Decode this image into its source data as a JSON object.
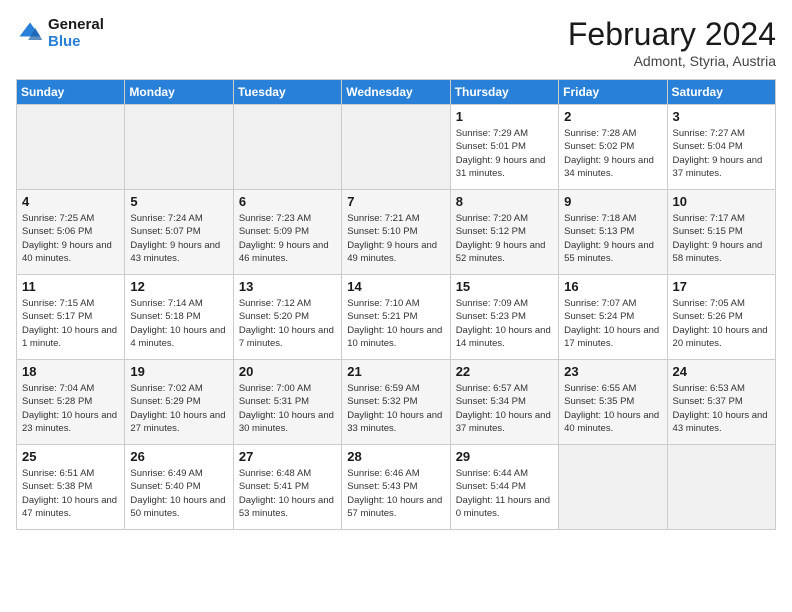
{
  "logo": {
    "line1": "General",
    "line2": "Blue"
  },
  "title": "February 2024",
  "subtitle": "Admont, Styria, Austria",
  "days_of_week": [
    "Sunday",
    "Monday",
    "Tuesday",
    "Wednesday",
    "Thursday",
    "Friday",
    "Saturday"
  ],
  "weeks": [
    [
      {
        "day": "",
        "empty": true
      },
      {
        "day": "",
        "empty": true
      },
      {
        "day": "",
        "empty": true
      },
      {
        "day": "",
        "empty": true
      },
      {
        "day": "1",
        "sunrise": "7:29 AM",
        "sunset": "5:01 PM",
        "daylight": "9 hours and 31 minutes."
      },
      {
        "day": "2",
        "sunrise": "7:28 AM",
        "sunset": "5:02 PM",
        "daylight": "9 hours and 34 minutes."
      },
      {
        "day": "3",
        "sunrise": "7:27 AM",
        "sunset": "5:04 PM",
        "daylight": "9 hours and 37 minutes."
      }
    ],
    [
      {
        "day": "4",
        "sunrise": "7:25 AM",
        "sunset": "5:06 PM",
        "daylight": "9 hours and 40 minutes."
      },
      {
        "day": "5",
        "sunrise": "7:24 AM",
        "sunset": "5:07 PM",
        "daylight": "9 hours and 43 minutes."
      },
      {
        "day": "6",
        "sunrise": "7:23 AM",
        "sunset": "5:09 PM",
        "daylight": "9 hours and 46 minutes."
      },
      {
        "day": "7",
        "sunrise": "7:21 AM",
        "sunset": "5:10 PM",
        "daylight": "9 hours and 49 minutes."
      },
      {
        "day": "8",
        "sunrise": "7:20 AM",
        "sunset": "5:12 PM",
        "daylight": "9 hours and 52 minutes."
      },
      {
        "day": "9",
        "sunrise": "7:18 AM",
        "sunset": "5:13 PM",
        "daylight": "9 hours and 55 minutes."
      },
      {
        "day": "10",
        "sunrise": "7:17 AM",
        "sunset": "5:15 PM",
        "daylight": "9 hours and 58 minutes."
      }
    ],
    [
      {
        "day": "11",
        "sunrise": "7:15 AM",
        "sunset": "5:17 PM",
        "daylight": "10 hours and 1 minute."
      },
      {
        "day": "12",
        "sunrise": "7:14 AM",
        "sunset": "5:18 PM",
        "daylight": "10 hours and 4 minutes."
      },
      {
        "day": "13",
        "sunrise": "7:12 AM",
        "sunset": "5:20 PM",
        "daylight": "10 hours and 7 minutes."
      },
      {
        "day": "14",
        "sunrise": "7:10 AM",
        "sunset": "5:21 PM",
        "daylight": "10 hours and 10 minutes."
      },
      {
        "day": "15",
        "sunrise": "7:09 AM",
        "sunset": "5:23 PM",
        "daylight": "10 hours and 14 minutes."
      },
      {
        "day": "16",
        "sunrise": "7:07 AM",
        "sunset": "5:24 PM",
        "daylight": "10 hours and 17 minutes."
      },
      {
        "day": "17",
        "sunrise": "7:05 AM",
        "sunset": "5:26 PM",
        "daylight": "10 hours and 20 minutes."
      }
    ],
    [
      {
        "day": "18",
        "sunrise": "7:04 AM",
        "sunset": "5:28 PM",
        "daylight": "10 hours and 23 minutes."
      },
      {
        "day": "19",
        "sunrise": "7:02 AM",
        "sunset": "5:29 PM",
        "daylight": "10 hours and 27 minutes."
      },
      {
        "day": "20",
        "sunrise": "7:00 AM",
        "sunset": "5:31 PM",
        "daylight": "10 hours and 30 minutes."
      },
      {
        "day": "21",
        "sunrise": "6:59 AM",
        "sunset": "5:32 PM",
        "daylight": "10 hours and 33 minutes."
      },
      {
        "day": "22",
        "sunrise": "6:57 AM",
        "sunset": "5:34 PM",
        "daylight": "10 hours and 37 minutes."
      },
      {
        "day": "23",
        "sunrise": "6:55 AM",
        "sunset": "5:35 PM",
        "daylight": "10 hours and 40 minutes."
      },
      {
        "day": "24",
        "sunrise": "6:53 AM",
        "sunset": "5:37 PM",
        "daylight": "10 hours and 43 minutes."
      }
    ],
    [
      {
        "day": "25",
        "sunrise": "6:51 AM",
        "sunset": "5:38 PM",
        "daylight": "10 hours and 47 minutes."
      },
      {
        "day": "26",
        "sunrise": "6:49 AM",
        "sunset": "5:40 PM",
        "daylight": "10 hours and 50 minutes."
      },
      {
        "day": "27",
        "sunrise": "6:48 AM",
        "sunset": "5:41 PM",
        "daylight": "10 hours and 53 minutes."
      },
      {
        "day": "28",
        "sunrise": "6:46 AM",
        "sunset": "5:43 PM",
        "daylight": "10 hours and 57 minutes."
      },
      {
        "day": "29",
        "sunrise": "6:44 AM",
        "sunset": "5:44 PM",
        "daylight": "11 hours and 0 minutes."
      },
      {
        "day": "",
        "empty": true
      },
      {
        "day": "",
        "empty": true
      }
    ]
  ],
  "labels": {
    "sunrise_prefix": "Sunrise: ",
    "sunset_prefix": "Sunset: ",
    "daylight_prefix": "Daylight: "
  }
}
